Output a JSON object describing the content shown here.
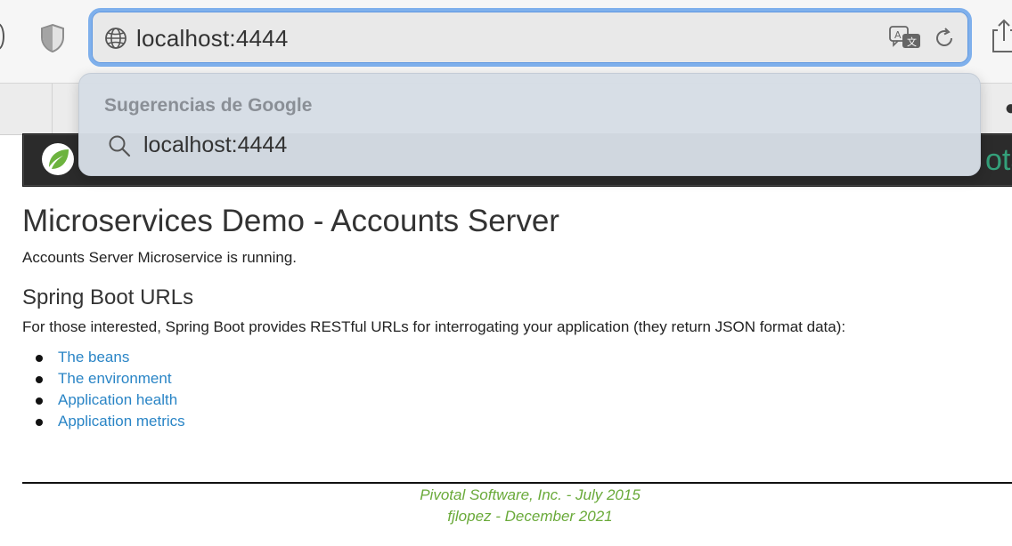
{
  "browser": {
    "url": "localhost:4444",
    "icons": {
      "privacy": "shield-icon",
      "site": "globe-icon",
      "translate": "translate-icon",
      "reload": "reload-icon",
      "share": "share-icon"
    },
    "suggestions": {
      "header": "Sugerencias de Google",
      "items": [
        {
          "text": "localhost:4444",
          "icon": "search-icon"
        }
      ]
    }
  },
  "page": {
    "header_brand_partial": "ota",
    "title": "Microservices Demo - Accounts Server",
    "status": "Accounts Server Microservice is running.",
    "section_title": "Spring Boot URLs",
    "intro": "For those interested, Spring Boot provides RESTful URLs for interrogating your application (they return JSON format data):",
    "links": [
      {
        "label": "The beans"
      },
      {
        "label": "The environment"
      },
      {
        "label": "Application health"
      },
      {
        "label": "Application metrics"
      }
    ],
    "footer": {
      "line1": "Pivotal Software, Inc. - July 2015",
      "line2": "fjlopez - December 2021"
    }
  },
  "colors": {
    "link": "#2a85c6",
    "footer_text": "#6aaa3a",
    "url_focus_ring": "#7fb0ec",
    "header_bg": "#2b2b2b",
    "spring_green": "#6db33f"
  }
}
